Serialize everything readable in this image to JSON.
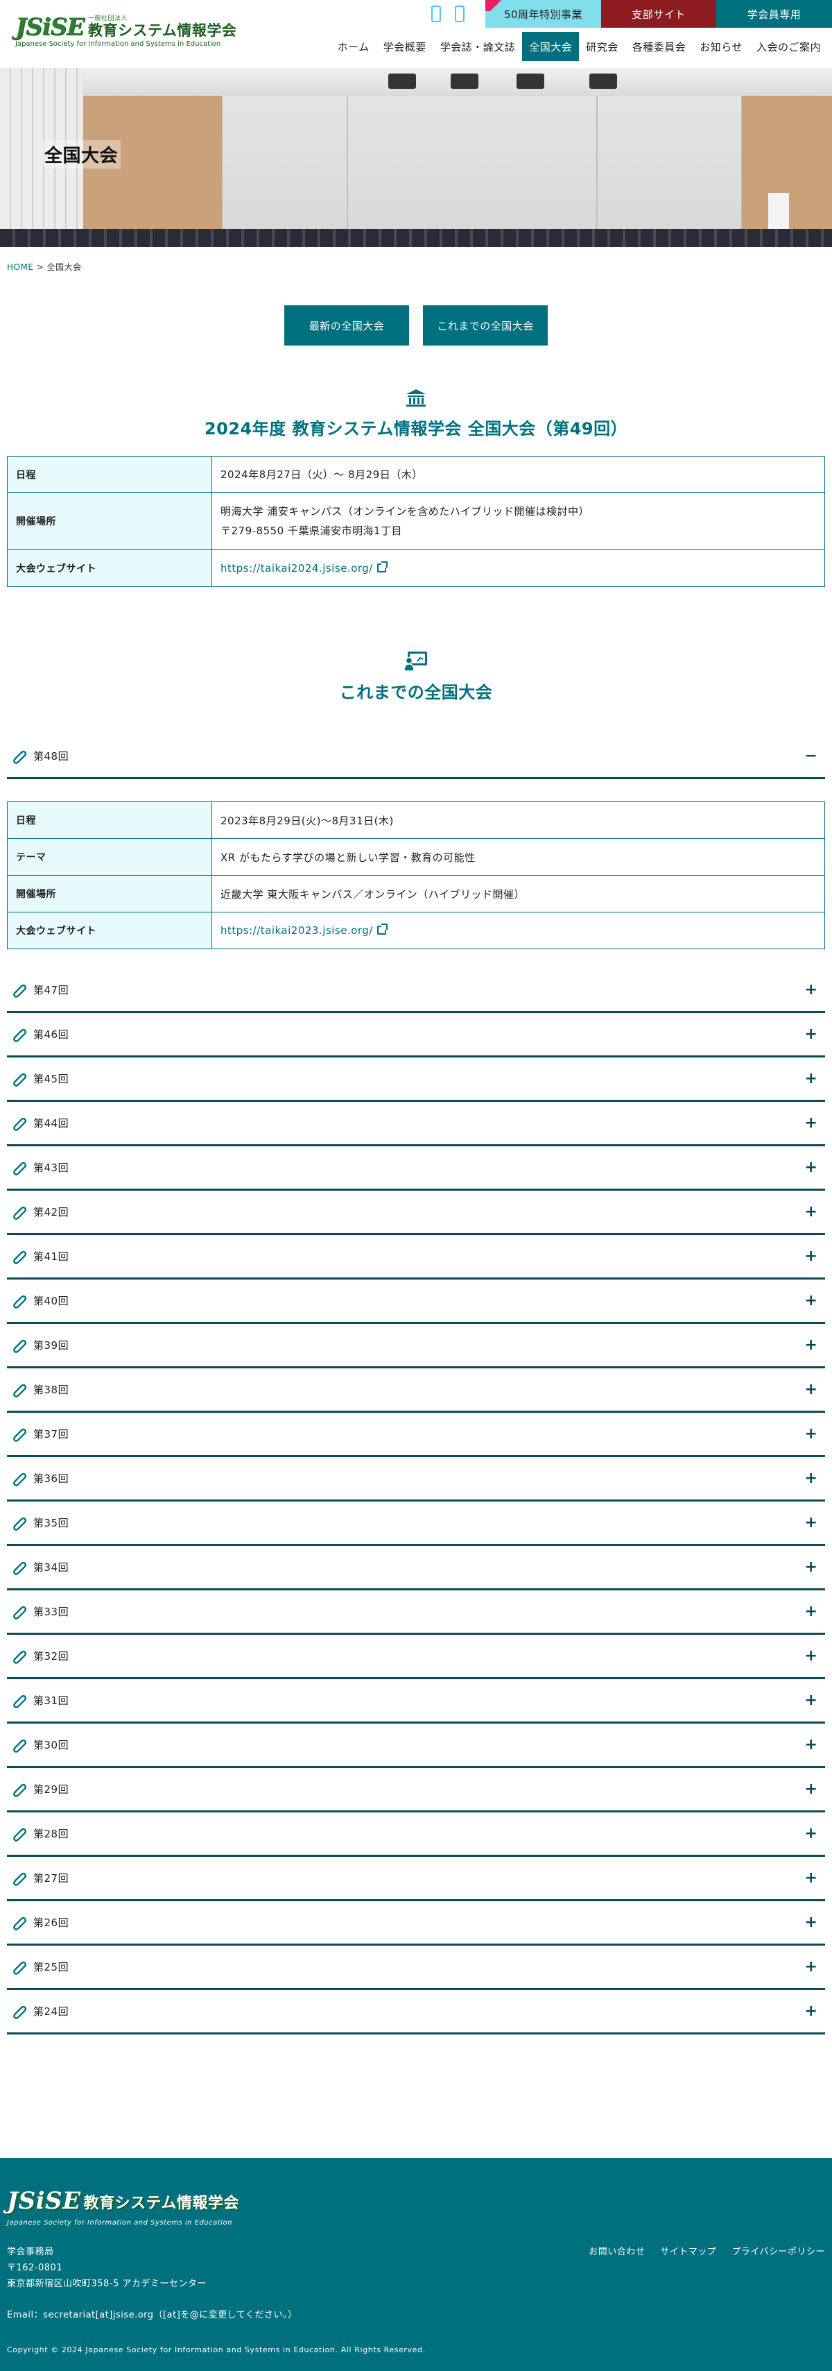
{
  "header": {
    "logo_mark": "JSiSE",
    "logo_small": "一般社団法人",
    "logo_jp": "教育システム情報学会",
    "logo_en": "Japanese Society for Information and Systems in Education",
    "top_buttons": [
      "50周年特別事業",
      "支部サイト",
      "学会員専用"
    ],
    "nav": [
      "ホーム",
      "学会概要",
      "学会誌・論文誌",
      "全国大会",
      "研究会",
      "各種委員会",
      "お知らせ",
      "入会のご案内"
    ],
    "nav_active": "全国大会",
    "colors": {
      "accent": "#00707f",
      "branch": "#8e1b22",
      "anniversary": "#80deea"
    }
  },
  "hero": {
    "title": "全国大会"
  },
  "breadcrumb": {
    "home": "HOME",
    "sep": ">",
    "current": "全国大会"
  },
  "tabs": [
    "最新の全国大会",
    "これまでの全国大会"
  ],
  "latest": {
    "icon": "building-icon",
    "title": "2024年度 教育システム情報学会 全国大会（第49回）",
    "rows": {
      "date_label": "日程",
      "date_value": "2024年8月27日（火）〜 8月29日（木）",
      "venue_label": "開催場所",
      "venue_line1": "明海大学 浦安キャンパス（オンラインを含めたハイブリッド開催は検討中）",
      "venue_line2": "〒279-8550 千葉県浦安市明海1丁目",
      "site_label": "大会ウェブサイト",
      "site_url": "https://taikai2024.jsise.org/"
    }
  },
  "past": {
    "icon": "presentation-icon",
    "title": "これまでの全国大会",
    "open": {
      "label": "第48回",
      "toggle": "−",
      "date_label": "日程",
      "date_value": "2023年8月29日(火)〜8月31日(木)",
      "theme_label": "テーマ",
      "theme_value": "XR がもたらす学びの場と新しい学習・教育の可能性",
      "venue_label": "開催場所",
      "venue_value": "近畿大学 東大阪キャンパス／オンライン（ハイブリッド開催）",
      "site_label": "大会ウェブサイト",
      "site_url": "https://taikai2023.jsise.org/"
    },
    "collapsed_toggle": "+",
    "items": [
      "第47回",
      "第46回",
      "第45回",
      "第44回",
      "第43回",
      "第42回",
      "第41回",
      "第40回",
      "第39回",
      "第38回",
      "第37回",
      "第36回",
      "第35回",
      "第34回",
      "第33回",
      "第32回",
      "第31回",
      "第30回",
      "第29回",
      "第28回",
      "第27回",
      "第26回",
      "第25回",
      "第24回"
    ]
  },
  "footer": {
    "logo_mark": "JSiSE",
    "logo_jp": "教育システム情報学会",
    "logo_en": "Japanese Society for Information and Systems in Education",
    "office": "学会事務局",
    "zip": "〒162-0801",
    "address": "東京都新宿区山吹町358-5 アカデミーセンター",
    "email": "Email：secretariat[at]jsise.org（[at]を@に変更してください。）",
    "links": [
      "お問い合わせ",
      "サイトマップ",
      "プライバシーポリシー"
    ],
    "copyright": "Copyright © 2024 Japanese Society for Information and Systems in Education. All Rights Reserved."
  }
}
